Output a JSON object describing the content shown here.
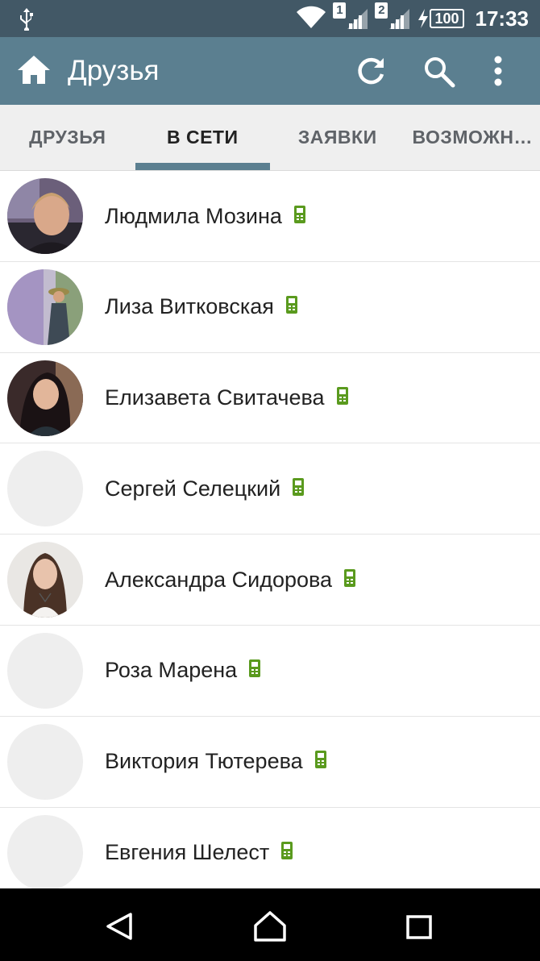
{
  "status_bar": {
    "sim1": "1",
    "sim2": "2",
    "battery": "100",
    "time": "17:33",
    "icons": [
      "usb-icon",
      "wifi-icon",
      "signal-icon",
      "charging-icon",
      "battery-icon"
    ]
  },
  "app_bar": {
    "title": "Друзья",
    "icons": [
      "home-icon",
      "refresh-icon",
      "search-icon",
      "more-vert-icon"
    ]
  },
  "tabs": [
    {
      "label": "ДРУЗЬЯ",
      "active": false
    },
    {
      "label": "В СЕТИ",
      "active": true
    },
    {
      "label": "ЗАЯВКИ",
      "active": false
    },
    {
      "label": "ВОЗМОЖН…",
      "active": false
    }
  ],
  "friends": [
    {
      "name": "Людмила Мозина",
      "avatar": "photo",
      "status": "mobile-online-icon"
    },
    {
      "name": "Лиза Витковская",
      "avatar": "photo",
      "status": "mobile-online-icon"
    },
    {
      "name": "Елизавета Свитачева",
      "avatar": "photo",
      "status": "mobile-online-icon"
    },
    {
      "name": "Сергей Селецкий",
      "avatar": "placeholder",
      "status": "mobile-online-icon"
    },
    {
      "name": "Александра Сидорова",
      "avatar": "photo",
      "status": "mobile-online-icon"
    },
    {
      "name": "Роза Марена",
      "avatar": "placeholder",
      "status": "mobile-online-icon"
    },
    {
      "name": "Виктория Тютерева",
      "avatar": "placeholder",
      "status": "mobile-online-icon"
    },
    {
      "name": "Евгения Шелест",
      "avatar": "placeholder",
      "status": "mobile-online-icon"
    }
  ],
  "nav_bar": {
    "icons": [
      "back-icon",
      "home-nav-icon",
      "recents-icon"
    ]
  },
  "colors": {
    "status_bar": "#425866",
    "app_bar": "#5b7f90",
    "tab_indicator": "#5b7f90",
    "online_icon": "#5a9a1e"
  }
}
